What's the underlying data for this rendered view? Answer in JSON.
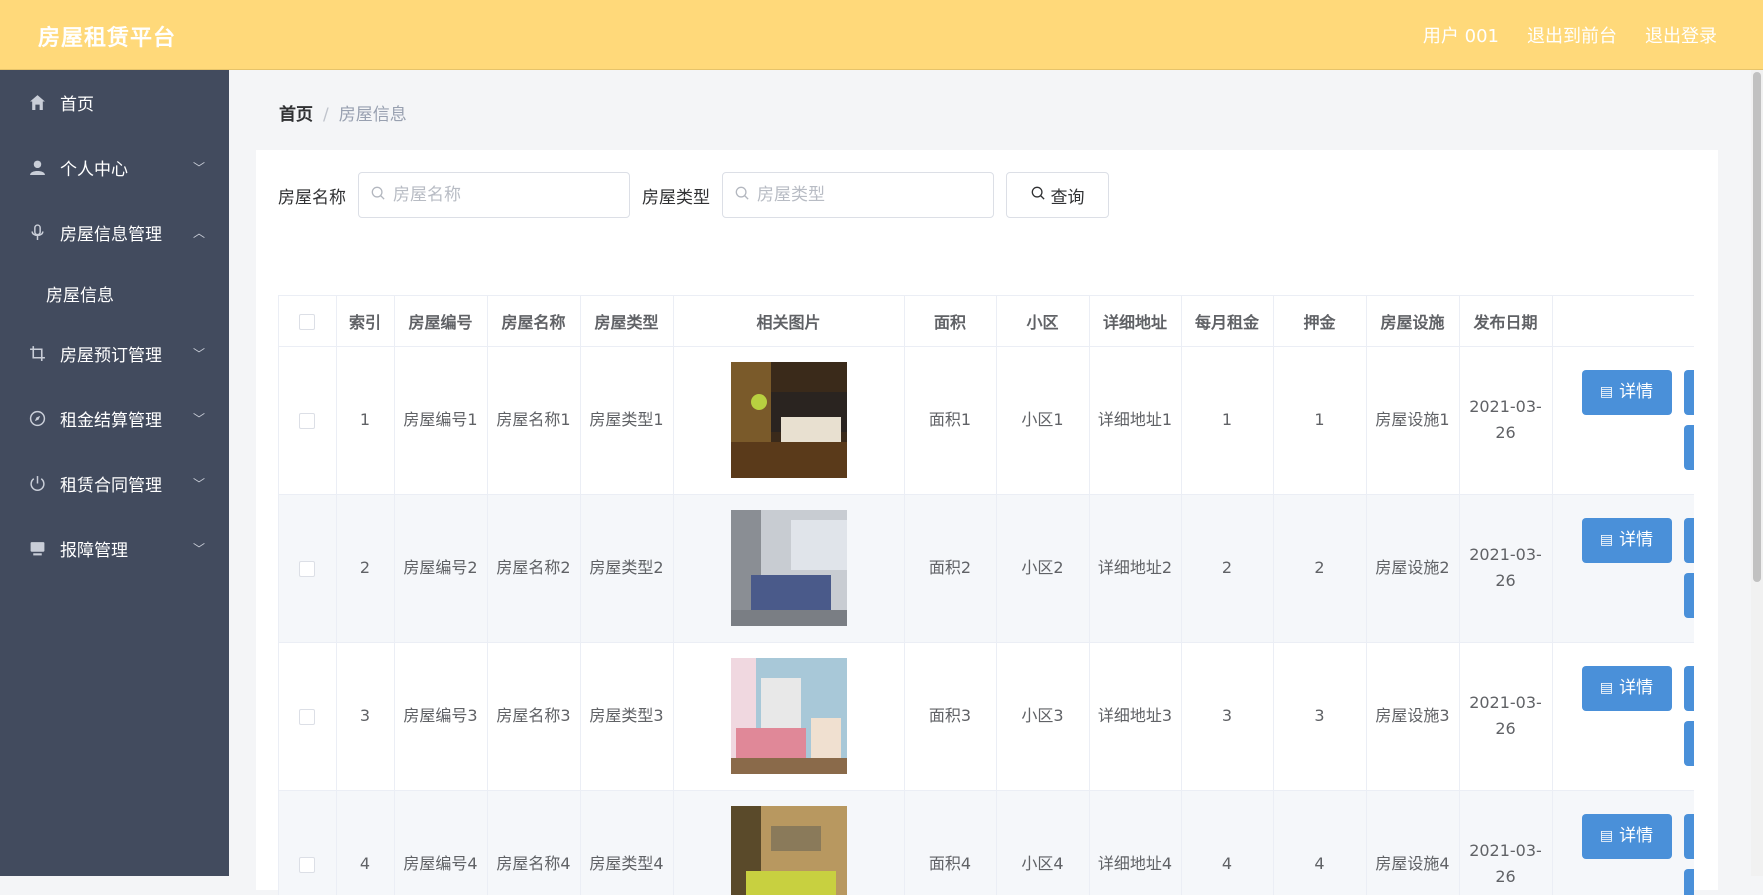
{
  "header": {
    "brand": "房屋租赁平台",
    "user": "用户 001",
    "back_front": "退出到前台",
    "logout": "退出登录"
  },
  "sidebar": {
    "items": [
      {
        "label": "首页",
        "icon": "home-icon"
      },
      {
        "label": "个人中心",
        "icon": "user-icon"
      },
      {
        "label": "房屋信息管理",
        "icon": "mic-icon"
      },
      {
        "label": "房屋信息",
        "icon": ""
      },
      {
        "label": "房屋预订管理",
        "icon": "crop-icon"
      },
      {
        "label": "租金结算管理",
        "icon": "compass-icon"
      },
      {
        "label": "租赁合同管理",
        "icon": "power-icon"
      },
      {
        "label": "报障管理",
        "icon": "monitor-icon"
      }
    ]
  },
  "breadcrumb": {
    "home": "首页",
    "separator": "/",
    "current": "房屋信息"
  },
  "search": {
    "name_label": "房屋名称",
    "name_placeholder": "房屋名称",
    "type_label": "房屋类型",
    "type_placeholder": "房屋类型",
    "query_label": "查询"
  },
  "table": {
    "headers": [
      "索引",
      "房屋编号",
      "房屋名称",
      "房屋类型",
      "相关图片",
      "面积",
      "小区",
      "详细地址",
      "每月租金",
      "押金",
      "房屋设施",
      "发布日期",
      ""
    ],
    "rows": [
      {
        "index": "1",
        "code": "房屋编号1",
        "name": "房屋名称1",
        "type": "房屋类型1",
        "area": "面积1",
        "community": "小区1",
        "address": "详细地址1",
        "rent": "1",
        "deposit": "1",
        "facility": "房屋设施1",
        "date": "2021-03-26",
        "detail": "详情"
      },
      {
        "index": "2",
        "code": "房屋编号2",
        "name": "房屋名称2",
        "type": "房屋类型2",
        "area": "面积2",
        "community": "小区2",
        "address": "详细地址2",
        "rent": "2",
        "deposit": "2",
        "facility": "房屋设施2",
        "date": "2021-03-26",
        "detail": "详情"
      },
      {
        "index": "3",
        "code": "房屋编号3",
        "name": "房屋名称3",
        "type": "房屋类型3",
        "area": "面积3",
        "community": "小区3",
        "address": "详细地址3",
        "rent": "3",
        "deposit": "3",
        "facility": "房屋设施3",
        "date": "2021-03-26",
        "detail": "详情"
      },
      {
        "index": "4",
        "code": "房屋编号4",
        "name": "房屋名称4",
        "type": "房屋类型4",
        "area": "面积4",
        "community": "小区4",
        "address": "详细地址4",
        "rent": "4",
        "deposit": "4",
        "facility": "房屋设施4",
        "date": "2021-03-26",
        "detail": "详情"
      }
    ]
  },
  "colors": {
    "topbar": "#ffd97a",
    "sidebar": "#424b5e",
    "primary_button": "#4a90d9"
  }
}
